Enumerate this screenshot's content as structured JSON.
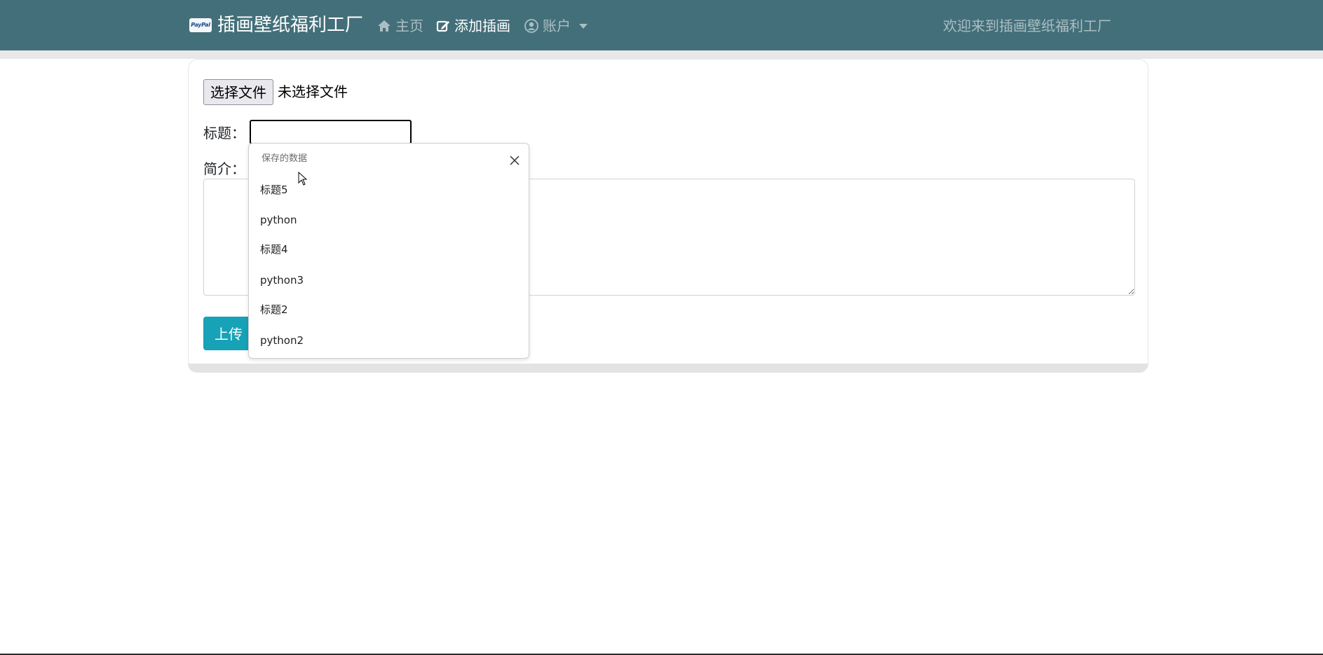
{
  "navbar": {
    "brand_logo_text": "PayPal",
    "brand_title": "插画壁纸福利工厂",
    "items": [
      {
        "label": "主页",
        "icon": "home-icon"
      },
      {
        "label": "添加插画",
        "icon": "edit-icon"
      },
      {
        "label": "账户",
        "icon": "user-circle-icon"
      }
    ],
    "welcome": "欢迎来到插画壁纸福利工厂",
    "background_color": "#436f7a"
  },
  "form": {
    "file_button_label": "选择文件",
    "file_status": "未选择文件",
    "title_label": "标题：",
    "title_value": "",
    "summary_label": "简介：",
    "summary_value": "",
    "upload_button_label": "上传",
    "upload_button_color": "#17a2b8"
  },
  "autocomplete": {
    "header": "保存的数据",
    "items": [
      "标题5",
      "python",
      "标题4",
      "python3",
      "标题2",
      "python2"
    ]
  }
}
